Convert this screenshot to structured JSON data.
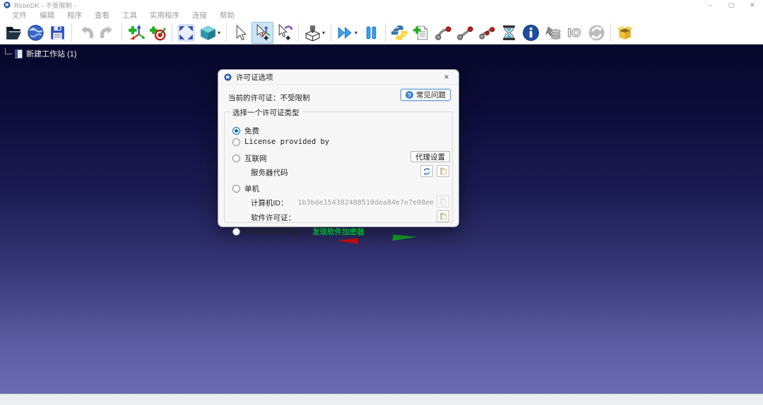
{
  "window": {
    "title": "RoboDK - 不受限制 -",
    "minimize": "–",
    "maximize": "▢",
    "close": "✕"
  },
  "menubar": {
    "items": [
      "文件",
      "编辑",
      "程序",
      "查看",
      "工具",
      "实用程序",
      "连接",
      "帮助"
    ]
  },
  "toolbar": {
    "caret": "▾",
    "io_label": "IO",
    "info_glyph": "i",
    "icons": [
      "open-station",
      "open-library-globe",
      "save-station",
      "undo",
      "redo",
      "add-reference-frame",
      "add-target",
      "fit-to-screen",
      "isometric-view-cube",
      "select-cursor",
      "move-reference-cursor",
      "move-object-cursor",
      "add-tool",
      "run-program-fast",
      "pause-simulation",
      "add-python-script",
      "add-program",
      "move-joint-instruction",
      "move-linear-instruction",
      "move-circular-instruction",
      "wait-instruction",
      "show-message-instruction",
      "set-speed-instruction",
      "set-io-instruction",
      "synchronize",
      "package-export"
    ]
  },
  "tree": {
    "station_label": "新建工作站 (1)"
  },
  "viewport": {
    "axes": [
      "x-axis-red",
      "y-axis-green"
    ]
  },
  "dialog": {
    "title": "许可证选项",
    "close": "×",
    "current_license": "当前的许可证：不受限制",
    "faq_icon": "?",
    "faq_button": "常见问题",
    "group_title": "选择一个许可证类型",
    "radio_free": "免费",
    "radio_provided": "License provided by",
    "radio_internet": "互联网",
    "proxy_button": "代理设置",
    "server_code_label": "服务器代码",
    "radio_standalone": "单机",
    "computer_id_label": "计算机ID：",
    "computer_id_value": "1b3bde154382488510dea84e7e7e08ee",
    "software_license_label": "软件许可证：",
    "radio_usb": "USB软件保护器",
    "dongle_link": "发现软件加密器"
  },
  "colors": {
    "viewport_top": "#07072b",
    "viewport_bottom": "#6c6bb1",
    "link_green": "#00b22d",
    "accent_blue": "#0a6cc4",
    "active_tool_bg": "#cde4f7"
  }
}
